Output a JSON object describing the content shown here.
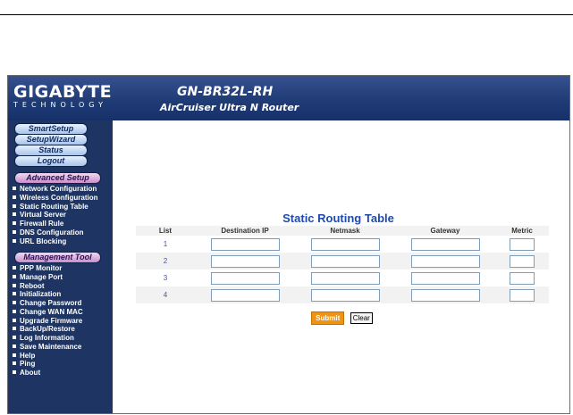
{
  "header": {
    "brand": "GIGABYTE",
    "brand_tagline": "TECHNOLOGY",
    "model": "GN-BR32L-RH",
    "product_name": "AirCruiser Ultra N Router"
  },
  "top_buttons": [
    "SmartSetup",
    "SetupWizard",
    "Status",
    "Logout"
  ],
  "advanced_setup": {
    "title": "Advanced Setup",
    "items": [
      "Network Configuration",
      "Wireless Configuration",
      "Static Routing Table",
      "Virtual Server",
      "Firewall Rule",
      "DNS Configuration",
      "URL Blocking"
    ]
  },
  "management_tool": {
    "title": "Management Tool",
    "items": [
      "PPP Monitor",
      "Manage Port",
      "Reboot",
      "Initialization",
      "Change Password",
      "Change WAN MAC",
      "Upgrade Firmware",
      "BackUp/Restore",
      "Log Information",
      "Save Maintenance",
      "Help",
      "Ping",
      "About"
    ]
  },
  "main": {
    "title": "Static Routing Table",
    "columns": [
      "List",
      "Destination IP",
      "Netmask",
      "Gateway",
      "Metric"
    ],
    "rows": [
      {
        "list": "1",
        "destination_ip": "",
        "netmask": "",
        "gateway": "",
        "metric": ""
      },
      {
        "list": "2",
        "destination_ip": "",
        "netmask": "",
        "gateway": "",
        "metric": ""
      },
      {
        "list": "3",
        "destination_ip": "",
        "netmask": "",
        "gateway": "",
        "metric": ""
      },
      {
        "list": "4",
        "destination_ip": "",
        "netmask": "",
        "gateway": "",
        "metric": ""
      }
    ],
    "submit_label": "Submit",
    "clear_label": "Clear"
  },
  "colors": {
    "banner": "#203c76",
    "sidebar": "#1e3463",
    "title_blue": "#1f4aa8",
    "submit_orange": "#ee9412",
    "pill_blue": "#a9c4ea",
    "pill_purple": "#c88fcb"
  }
}
